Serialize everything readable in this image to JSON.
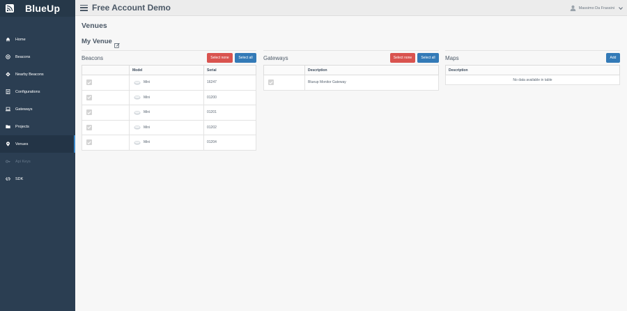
{
  "brand": {
    "name": "BlueUp"
  },
  "topbar": {
    "title": "Free Account Demo",
    "user_name": "Massimo Da Frassini"
  },
  "sidebar": {
    "items": [
      {
        "label": "Home",
        "icon": "home-icon"
      },
      {
        "label": "Beacons",
        "icon": "beacon-icon"
      },
      {
        "label": "Nearby Beacons",
        "icon": "nearby-icon"
      },
      {
        "label": "Configurations",
        "icon": "document-icon"
      },
      {
        "label": "Gateways",
        "icon": "laptop-icon"
      },
      {
        "label": "Projects",
        "icon": "folder-icon"
      },
      {
        "label": "Venues",
        "icon": "map-pin-icon"
      },
      {
        "label": "Api Keys",
        "icon": "key-icon"
      },
      {
        "label": "SDK",
        "icon": "code-icon"
      }
    ]
  },
  "main": {
    "title": "Venues",
    "venue_name": "My Venue",
    "beacons": {
      "title": "Beacons",
      "select_none": "Select none",
      "select_all": "Select all",
      "columns": [
        "",
        "Model",
        "Serial"
      ],
      "rows": [
        {
          "model": "Mini",
          "serial": "16247"
        },
        {
          "model": "Mini",
          "serial": "01200"
        },
        {
          "model": "Mini",
          "serial": "01201"
        },
        {
          "model": "Mini",
          "serial": "01202"
        },
        {
          "model": "Mini",
          "serial": "01204"
        }
      ]
    },
    "gateways": {
      "title": "Gateways",
      "select_none": "Select none",
      "select_all": "Select all",
      "columns": [
        "",
        "Description"
      ],
      "rows": [
        {
          "description": "Blueup Monitor Gateway"
        }
      ]
    },
    "maps": {
      "title": "Maps",
      "add": "Add",
      "columns": [
        "Description"
      ],
      "empty": "No data available in table"
    }
  },
  "colors": {
    "sidebar_bg": "#2b3e52",
    "active_indicator": "#3a86c8",
    "btn_danger": "#d9534f",
    "btn_primary": "#337ab7"
  }
}
